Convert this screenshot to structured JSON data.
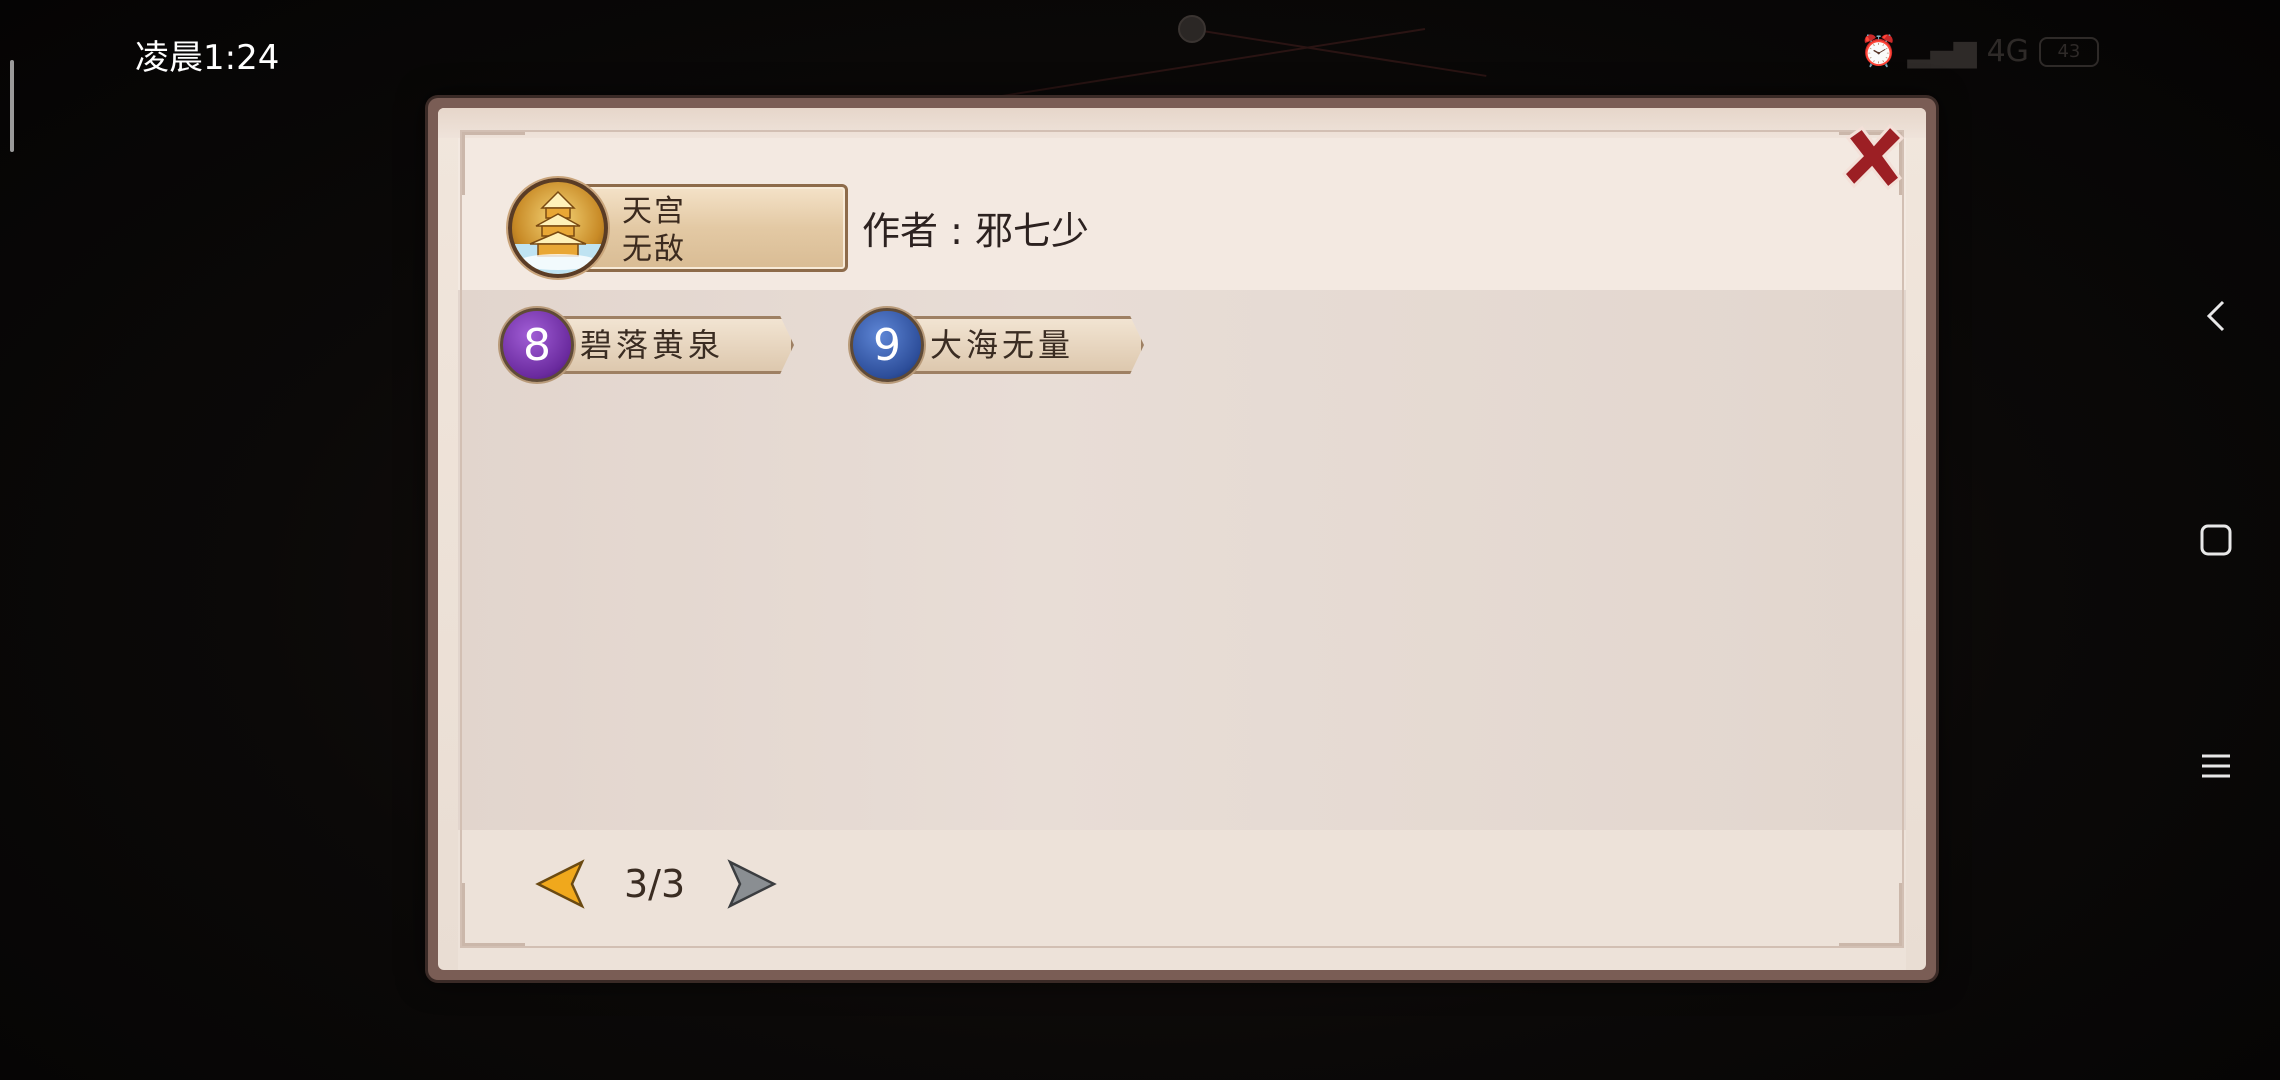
{
  "status_bar": {
    "time": "凌晨1:24",
    "network": "4G",
    "battery": "43"
  },
  "dialog": {
    "sect": {
      "line1": "天宫",
      "line2": "无敌"
    },
    "author": "作者 : 邪七少",
    "skills": [
      {
        "number": "8",
        "name": "碧落黄泉",
        "color": "#6a2a9e"
      },
      {
        "number": "9",
        "name": "大海无量",
        "color": "#2d4e9a"
      }
    ],
    "pager": {
      "text": "3/3"
    }
  },
  "colors": {
    "close_x": "#9c1f24",
    "prev_arrow": "#f0a81c",
    "next_arrow": "#8a8e92"
  }
}
